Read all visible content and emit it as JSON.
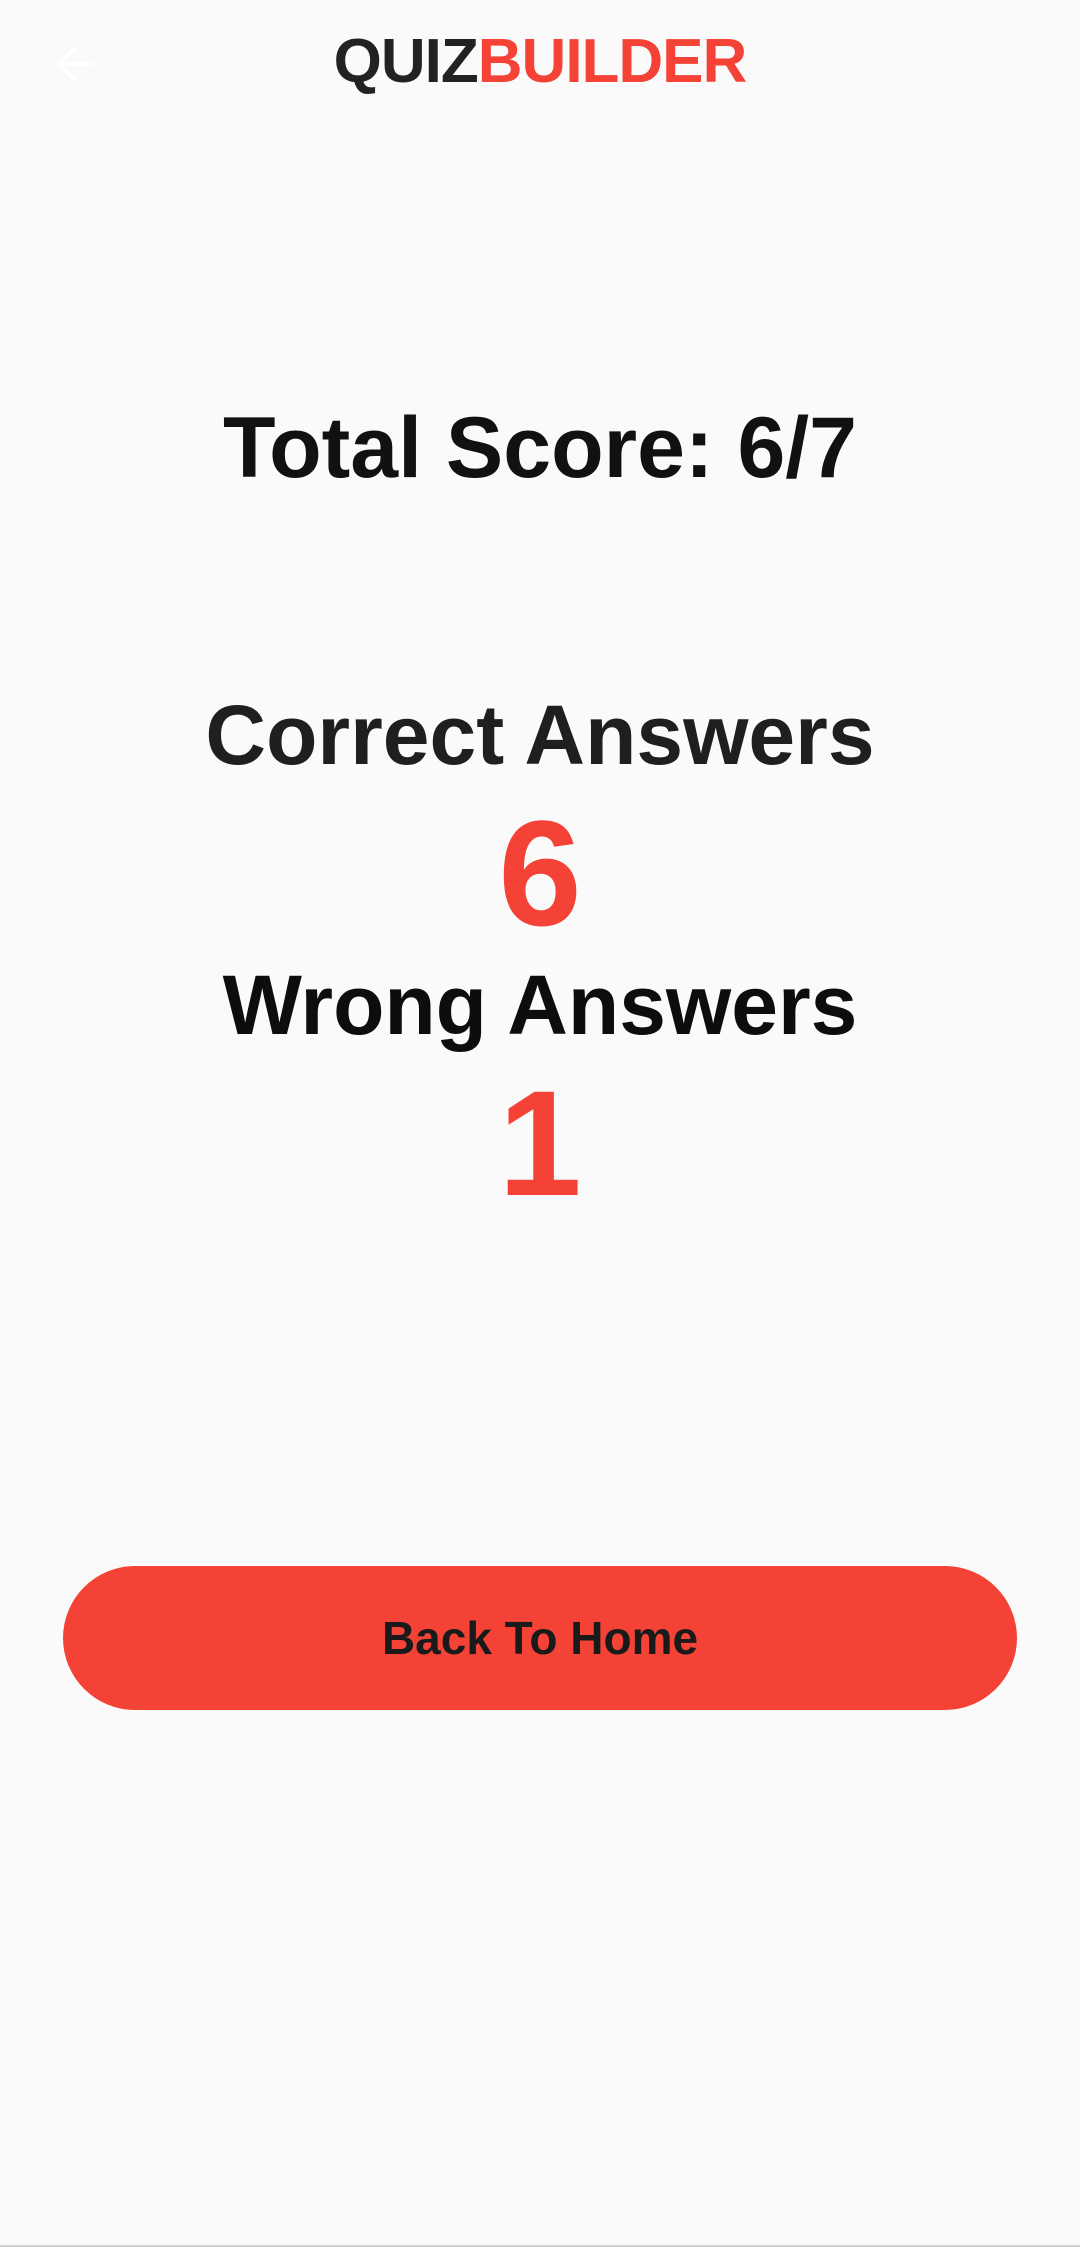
{
  "app_bar": {
    "back_icon": "arrow-left-icon",
    "title_part_a": "QUIZ",
    "title_part_b": "BUILDER"
  },
  "result": {
    "total_score": "Total Score: 6/7",
    "correct_label": "Correct Answers",
    "correct_count": "6",
    "wrong_label": "Wrong Answers",
    "wrong_count": "1"
  },
  "actions": {
    "home_label": "Back To Home"
  },
  "colors": {
    "accent": "#f44336",
    "background": "#fafafa",
    "text": "#111111"
  }
}
